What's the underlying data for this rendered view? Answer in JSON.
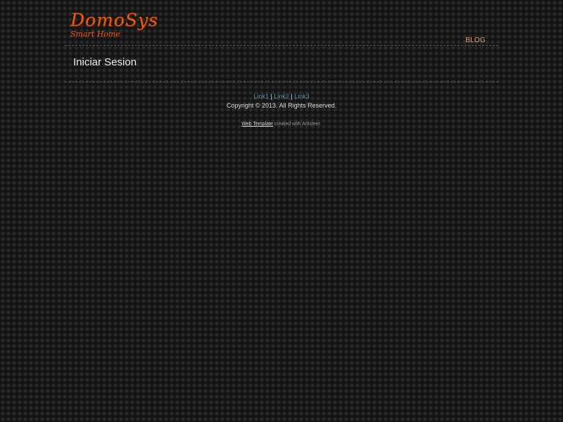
{
  "header": {
    "logo_title": "DomoSys",
    "logo_subtitle": "Smart Home",
    "nav": [
      {
        "label": "BLOG"
      }
    ]
  },
  "content": {
    "title": "Iniciar Sesion"
  },
  "footer": {
    "links": [
      {
        "label": "Link1"
      },
      {
        "label": "Link2"
      },
      {
        "label": "Link3"
      }
    ],
    "separator": "|",
    "copyright": "Copyright © 2013. All Rights Reserved.",
    "credit_link": "Web Template",
    "credit_text": "created with Artisteer."
  },
  "colors": {
    "brand": "#ef5a14",
    "nav": "#e8a56a",
    "link": "#5d8fa6",
    "background": "#1b1b1b"
  }
}
